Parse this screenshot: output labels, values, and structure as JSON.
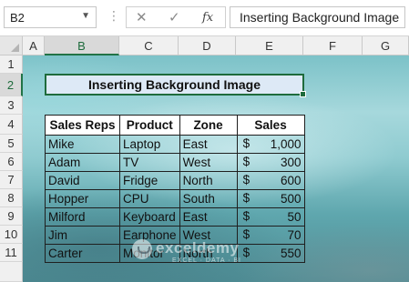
{
  "formula_bar": {
    "name_box": "B2",
    "name_box_dropdown_icon": "chevron-down-icon",
    "more_icon": "vertical-dots-icon",
    "cancel_icon": "close-icon",
    "enter_icon": "checkmark-icon",
    "fx_label": "fx",
    "formula_value": "Inserting Background Image"
  },
  "columns": [
    "A",
    "B",
    "C",
    "D",
    "E",
    "F",
    "G"
  ],
  "selected_column": "B",
  "rows": [
    "1",
    "2",
    "3",
    "4",
    "5",
    "6",
    "7",
    "8",
    "9",
    "10",
    "11"
  ],
  "selected_row": "2",
  "title": "Inserting Background Image",
  "table": {
    "headers": [
      "Sales Reps",
      "Product",
      "Zone",
      "Sales"
    ],
    "currency_symbol": "$",
    "rows": [
      {
        "rep": "Mike",
        "product": "Laptop",
        "zone": "East",
        "sales": "1,000"
      },
      {
        "rep": "Adam",
        "product": "TV",
        "zone": "West",
        "sales": "300"
      },
      {
        "rep": "David",
        "product": "Fridge",
        "zone": "North",
        "sales": "600"
      },
      {
        "rep": "Hopper",
        "product": "CPU",
        "zone": "South",
        "sales": "500"
      },
      {
        "rep": "Milford",
        "product": "Keyboard",
        "zone": "East",
        "sales": "50"
      },
      {
        "rep": "Jim",
        "product": "Earphone",
        "zone": "West",
        "sales": "70"
      },
      {
        "rep": "Carter",
        "product": "Monitor",
        "zone": "North",
        "sales": "550"
      }
    ]
  },
  "watermark": {
    "brand": "exceldemy",
    "tagline": "EXCEL · DATA · BI"
  }
}
